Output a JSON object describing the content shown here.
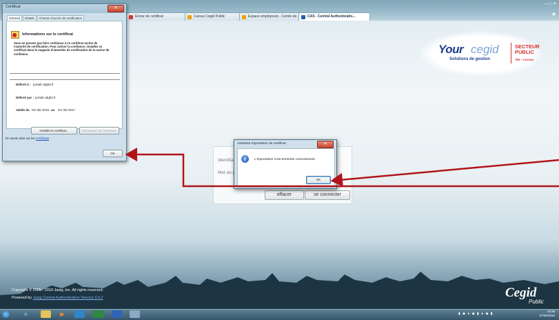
{
  "browser": {
    "tabs": [
      {
        "label": "Erreur de certificat",
        "color": "#d33"
      },
      {
        "label": "Cursus Cegid Public",
        "color": "#f0a000"
      },
      {
        "label": "Espace employeurs - Centre de...",
        "color": "#f0a000"
      },
      {
        "label": "CAS - Central Authenticatio...",
        "color": "#1e5fb3"
      }
    ],
    "window_controls": "—  □  ✕",
    "favorite_icon": "★"
  },
  "logo": {
    "your": "Your",
    "cegid": "cegid",
    "subtitle": "Solutions de gestion",
    "secteur": "SECTEUR",
    "public": "PUBLIC",
    "tagline": "RH - Cursus"
  },
  "login": {
    "identifiant_label": "Identifiant",
    "motdepasse_label": "Mot de passe",
    "clear_button": "effacer",
    "connect_button": "se connecter"
  },
  "cert_dialog": {
    "title": "Certificat",
    "close": "✕",
    "tabs": [
      "Général",
      "Détails",
      "Chemin d'accès de certification"
    ],
    "info_heading": "Informations sur le certificat",
    "warning": "Vous ne pouvez pas faire confiance à ce certificat racine de l'autorité de certification. Pour activer la confiance, installez ce certificat dans le magasin d'autorités de certification de la racine de confiance.",
    "issued_to_label": "Délivré à :",
    "issued_to": "portail.cdg52.fr",
    "issued_by_label": "Délivré par :",
    "issued_by": "portail.cdg52.fr",
    "valid_label": "Valide du",
    "valid_from": "01/ 06/ 2016",
    "valid_to_label": "au",
    "valid_to": "01/ 06/ 2017",
    "install_button": "Installer le certificat...",
    "issuer_button": "Déclaration de l'émetteur",
    "learn_more_prefix": "En savoir plus sur les",
    "learn_more_link": "certificats",
    "ok_button": "OK"
  },
  "import_dialog": {
    "title": "Assistant Importation du certificat",
    "close": "✕",
    "message": "L'importation s'est terminée correctement.",
    "ok_button": "OK"
  },
  "footer": {
    "copyright": "Copyright © 2005 - 2010 Jasig, Inc. All rights reserved.",
    "powered_prefix": "Powered by",
    "powered_link": "Jasig Central Authentication Service 3.4.2",
    "cegid": "Cegid",
    "public": "Public"
  },
  "taskbar": {
    "time": "15:26",
    "date": "07/06/2016"
  },
  "colors": {
    "arrow": "#b0141a",
    "link": "#1a4fb5",
    "brand_blue": "#1e3f8c",
    "brand_red": "#d62f2f"
  }
}
